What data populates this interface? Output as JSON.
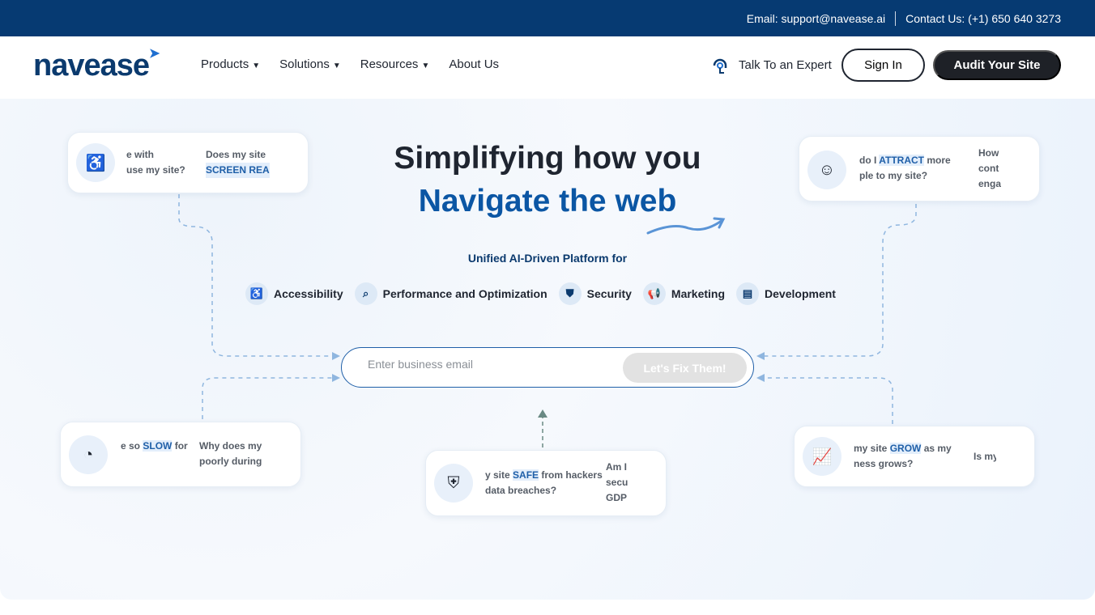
{
  "topbar": {
    "email": "Email: support@navease.ai",
    "contact": "Contact Us: (+1) 650 640 3273"
  },
  "nav": {
    "logo": "navease",
    "items": [
      {
        "label": "Products"
      },
      {
        "label": "Solutions"
      },
      {
        "label": "Resources"
      },
      {
        "label": "About Us"
      }
    ],
    "expert": "Talk To an Expert",
    "sign_in": "Sign In",
    "audit": "Audit Your Site"
  },
  "hero": {
    "title_line1": "Simplifying how you",
    "title_line2": "Navigate the web",
    "subtitle": "Unified AI-Driven Platform for",
    "categories": [
      {
        "label": "Accessibility"
      },
      {
        "label": "Performance and Optimization"
      },
      {
        "label": "Security"
      },
      {
        "label": "Marketing"
      },
      {
        "label": "Development"
      }
    ],
    "email_placeholder": "Enter business email",
    "cta": "Let's Fix Them!"
  },
  "cards": [
    {
      "a1": "e with",
      "a2": "use my site?",
      "b1": "Does my site",
      "b2": "SCREEN REA"
    },
    {
      "a1pre": "do I ",
      "a1hl": "ATTRACT",
      "a1post": " more",
      "a2": "ple to my site?",
      "b1": "How",
      "b2": "cont",
      "b3": "enga"
    },
    {
      "a1pre": "e so ",
      "a1hl": "SLOW",
      "a1post": " for",
      "b1": "Why does my",
      "b2": "poorly during"
    },
    {
      "a1pre": "y site ",
      "a1hl": "SAFE",
      "a1post": " from hackers",
      "a2": "data breaches?",
      "b1": "Am I",
      "b2": "secu",
      "b3": "GDP"
    },
    {
      "a1pre": "my site ",
      "a1hl": "GROW",
      "a1post": " as my",
      "a2": "ness grows?",
      "b1": "Is my"
    }
  ],
  "colors": {
    "brand": "#063a72",
    "accent": "#1f5fa8"
  }
}
